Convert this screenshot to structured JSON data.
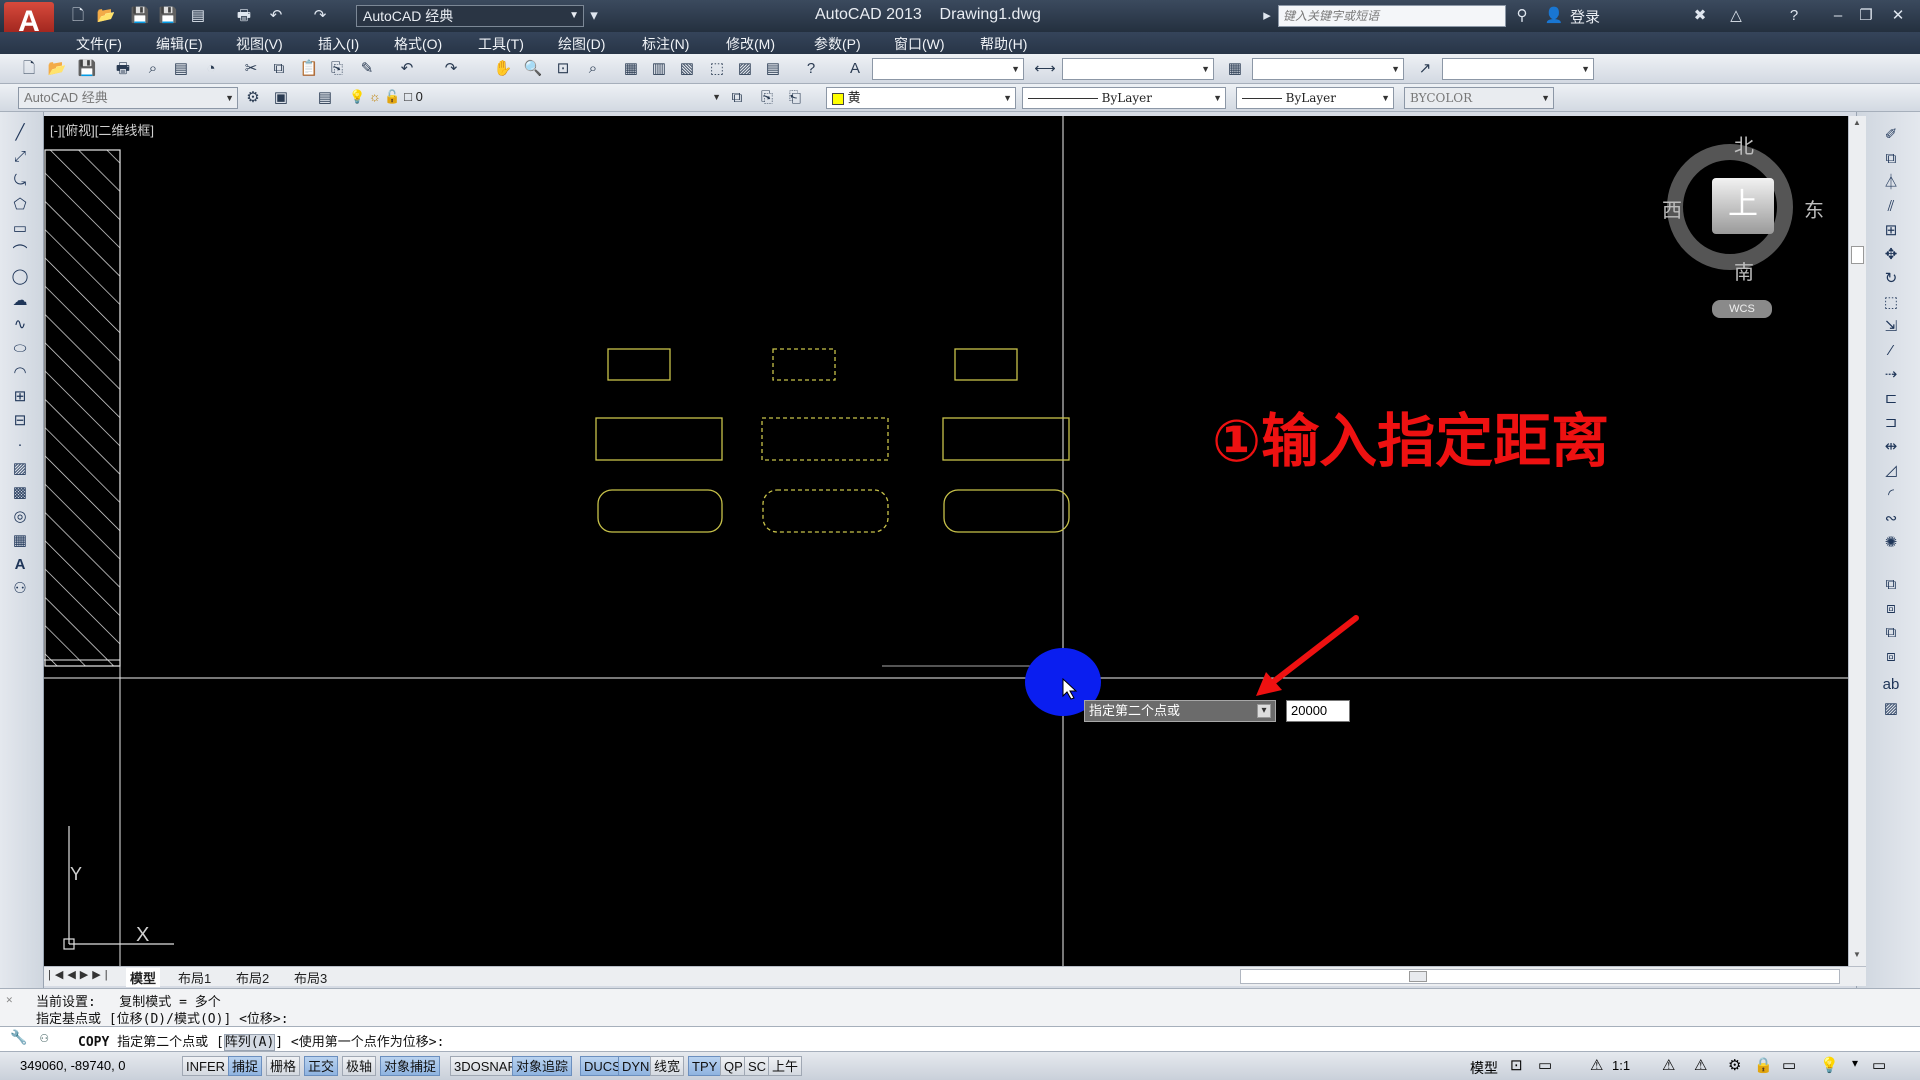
{
  "titlebar": {
    "app_name_title": "AutoCAD 2013",
    "file_name": "Drawing1.dwg",
    "workspace": "AutoCAD 经典",
    "search_placeholder": "键入关键字或短语",
    "login": "登录"
  },
  "menu": [
    "文件(F)",
    "编辑(E)",
    "视图(V)",
    "插入(I)",
    "格式(O)",
    "工具(T)",
    "绘图(D)",
    "标注(N)",
    "修改(M)",
    "参数(P)",
    "窗口(W)",
    "帮助(H)"
  ],
  "toolbar2": {
    "workspace_combo": "AutoCAD 经典",
    "layer_combo": "0",
    "color_combo": "黄",
    "linetype_combo": "ByLayer",
    "lineweight_combo": "ByLayer",
    "plotstyle_combo": "BYCOLOR"
  },
  "canvas": {
    "viewport_label": "[-][俯视][二维线框]",
    "compass": {
      "north": "北",
      "south": "南",
      "east": "东",
      "west": "西",
      "top": "上",
      "wcs": "WCS"
    },
    "ucs_x": "X",
    "ucs_y": "Y",
    "annotation": "①输入指定距离",
    "dyn_prompt": "指定第二个点或",
    "dyn_input_value": "20000"
  },
  "layout_tabs": [
    "模型",
    "布局1",
    "布局2",
    "布局3"
  ],
  "command": {
    "history_line1": "当前设置:   复制模式 = 多个",
    "history_line2": "指定基点或 [位移(D)/模式(O)] <位移>:",
    "current_cmd": "COPY",
    "current_prompt_a": "指定第二个点或 [",
    "current_option": "阵列(A)",
    "current_prompt_b": "] <使用第一个点作为位移>:"
  },
  "statusbar": {
    "coords": "349060, -89740, 0",
    "toggles": [
      {
        "label": "INFER",
        "on": false
      },
      {
        "label": "捕捉",
        "on": true
      },
      {
        "label": "栅格",
        "on": false
      },
      {
        "label": "正交",
        "on": true
      },
      {
        "label": "极轴",
        "on": false
      },
      {
        "label": "对象捕捉",
        "on": true
      },
      {
        "label": "3DOSNAP",
        "on": false
      },
      {
        "label": "对象追踪",
        "on": true
      },
      {
        "label": "DUCS",
        "on": true
      },
      {
        "label": "DYN",
        "on": true
      },
      {
        "label": "线宽",
        "on": false
      },
      {
        "label": "TPY",
        "on": true
      },
      {
        "label": "QP",
        "on": false
      },
      {
        "label": "SC",
        "on": false
      },
      {
        "label": "上午",
        "on": false
      }
    ],
    "model": "模型",
    "scale": "1:1"
  },
  "colors": {
    "canvas_bg": "#000000",
    "object_yellow": "#c8c24a",
    "annotation_red": "#ee1111",
    "cursor_blue": "#0a1ef0"
  }
}
